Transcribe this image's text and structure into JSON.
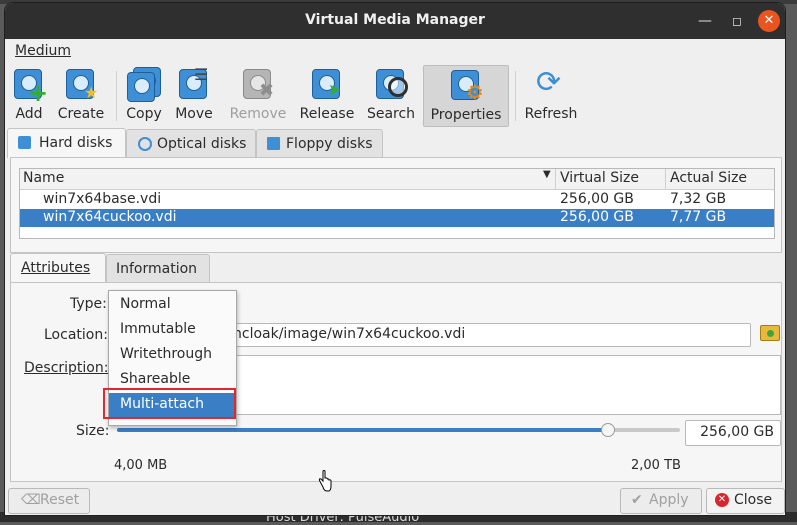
{
  "background": {
    "bottom_text": "Host Driver:   PulseAudio"
  },
  "window": {
    "title": "Virtual Media Manager"
  },
  "menu": {
    "medium": "Medium"
  },
  "toolbar": {
    "add": "Add",
    "create": "Create",
    "copy": "Copy",
    "move": "Move",
    "remove": "Remove",
    "release": "Release",
    "search": "Search",
    "properties": "Properties",
    "refresh": "Refresh"
  },
  "media_tabs": {
    "hard_disks": "Hard disks",
    "optical_disks": "Optical disks",
    "floppy_disks": "Floppy disks"
  },
  "table": {
    "headers": {
      "name": "Name",
      "virtual_size": "Virtual Size",
      "actual_size": "Actual Size"
    },
    "rows": [
      {
        "name": "win7x64base.vdi",
        "virtual_size": "256,00 GB",
        "actual_size": "7,32 GB"
      },
      {
        "name": "win7x64cuckoo.vdi",
        "virtual_size": "256,00 GB",
        "actual_size": "7,77 GB"
      }
    ]
  },
  "detail_tabs": {
    "attributes": "Attributes",
    "information": "Information"
  },
  "form": {
    "type_label": "Type:",
    "location_label": "Location:",
    "location_value": "ncloak/image/win7x64cuckoo.vdi",
    "description_label": "Description:",
    "size_label": "Size:",
    "size_value": "256,00 GB",
    "size_min": "4,00 MB",
    "size_max": "2,00 TB",
    "size_slider_fraction": 0.87
  },
  "type_dropdown": {
    "options": [
      "Normal",
      "Immutable",
      "Writethrough",
      "Shareable",
      "Multi-attach"
    ],
    "highlighted": "Multi-attach"
  },
  "buttons": {
    "reset": "Reset",
    "apply": "Apply",
    "close": "Close"
  },
  "colors": {
    "accent": "#3a7ec5",
    "highlight_box": "#e0282e",
    "close_window": "#e9541f"
  }
}
